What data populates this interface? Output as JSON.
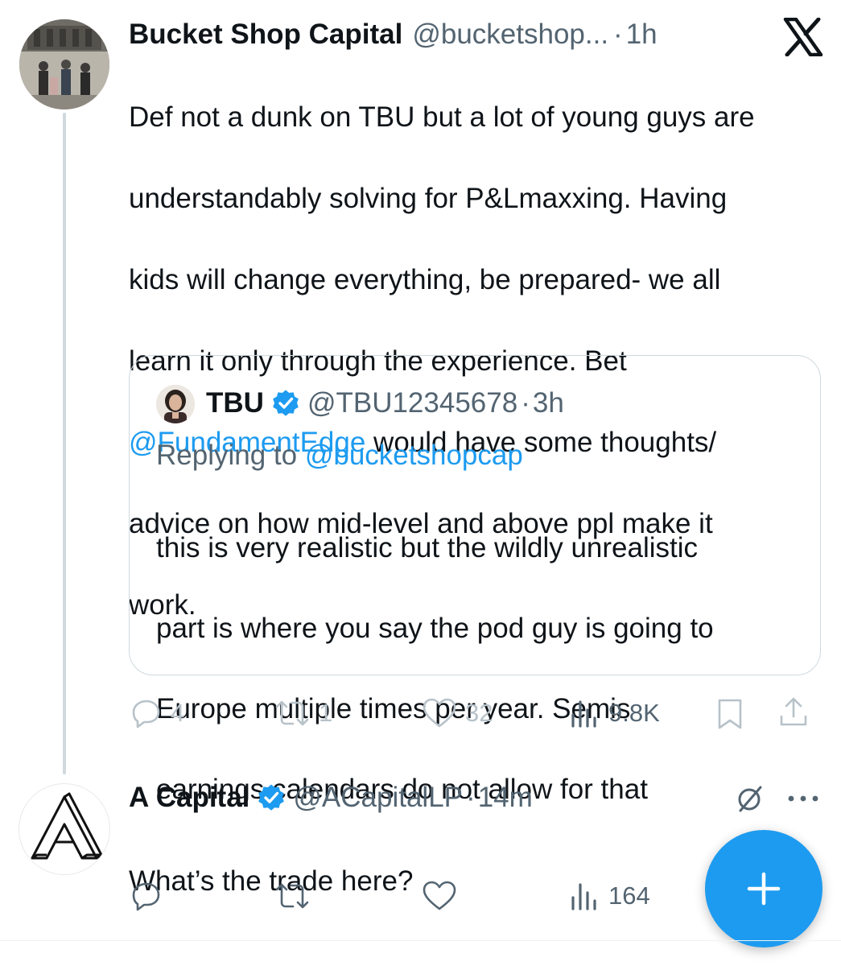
{
  "first_tweet": {
    "name": "Bucket Shop Capital",
    "handle": "@bucketshop...",
    "separator": "·",
    "time": "1h",
    "text_line_1": "Def not a dunk on TBU but a lot of young guys are",
    "text_line_2": "understandably solving for P&Lmaxxing.  Having",
    "text_line_3": "kids will change everything, be prepared- we all",
    "text_line_4": "learn it only through the experience.  Bet",
    "mention": "@FundamentEdge",
    "text_line_5_rest": " would have some thoughts/",
    "text_line_6": "advice on how mid-level and above ppl make it",
    "text_line_7": "work.",
    "quoted": {
      "name": "TBU",
      "handle": "@TBU12345678",
      "separator": "·",
      "time": "3h",
      "replying_prefix": "Replying to ",
      "replying_handle": "@bucketshopcap",
      "text_line_1": "this is very realistic but the wildly unrealistic",
      "text_line_2": "part is where you say the pod guy is going to",
      "text_line_3": "Europe multiple times per year. Semis",
      "text_line_4": "earnings calendars do not allow for that"
    },
    "actions": {
      "replies": "4",
      "reposts": "1",
      "likes": "32",
      "views": "9.8K"
    }
  },
  "second_tweet": {
    "name": "A Capital",
    "handle": "@ACapitalLP",
    "separator": "·",
    "time": "14m",
    "text": "What’s the trade here?",
    "actions": {
      "views": "164"
    }
  },
  "icons": {
    "platform_logo": "x-logo-icon",
    "verified": "verified-badge-icon",
    "reply": "reply-icon",
    "repost": "repost-icon",
    "like": "heart-icon",
    "views": "views-icon",
    "bookmark": "bookmark-icon",
    "share": "share-icon",
    "grok": "grok-icon",
    "more": "more-icon",
    "compose": "plus-icon"
  },
  "colors": {
    "accent": "#1d9bf0",
    "text": "#0f1419",
    "secondary": "#536471",
    "faded": "#b7c2c9",
    "border": "#cfd9de"
  }
}
